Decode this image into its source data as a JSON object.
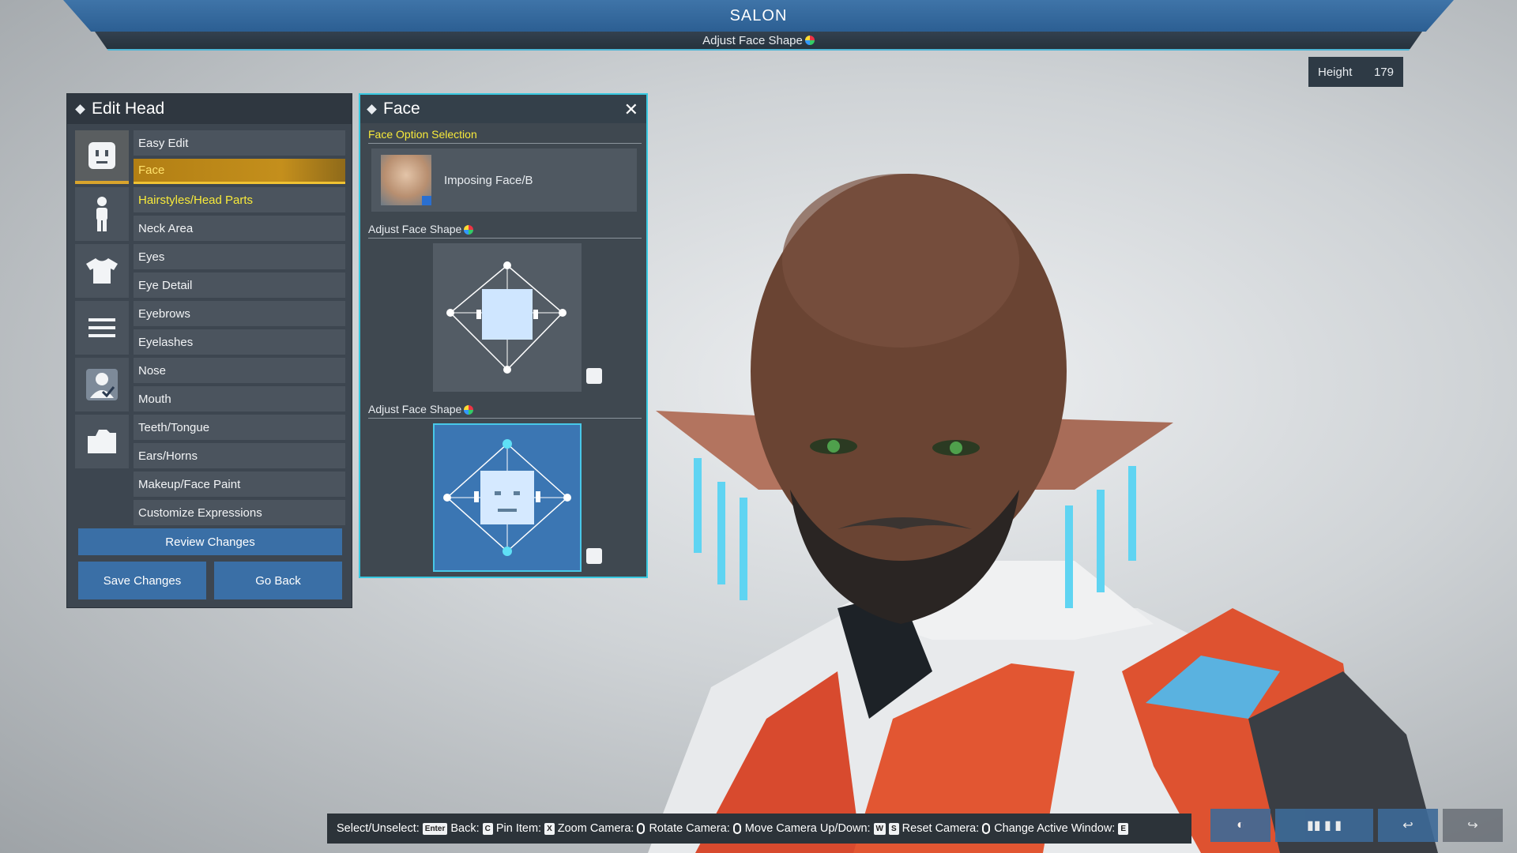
{
  "header": {
    "title": "SALON",
    "subtitle": "Adjust Face Shape"
  },
  "height_display": {
    "label": "Height",
    "value": "179"
  },
  "edit_head": {
    "title": "Edit Head",
    "menu": [
      {
        "label": "Easy Edit",
        "state": "normal"
      },
      {
        "label": "Face",
        "state": "selected"
      },
      {
        "label": "Hairstyles/Head Parts",
        "state": "highlight"
      },
      {
        "label": "Neck Area",
        "state": "normal"
      },
      {
        "label": "Eyes",
        "state": "normal"
      },
      {
        "label": "Eye Detail",
        "state": "normal"
      },
      {
        "label": "Eyebrows",
        "state": "normal"
      },
      {
        "label": "Eyelashes",
        "state": "normal"
      },
      {
        "label": "Nose",
        "state": "normal"
      },
      {
        "label": "Mouth",
        "state": "normal"
      },
      {
        "label": "Teeth/Tongue",
        "state": "normal"
      },
      {
        "label": "Ears/Horns",
        "state": "normal"
      },
      {
        "label": "Makeup/Face Paint",
        "state": "normal"
      },
      {
        "label": "Customize Expressions",
        "state": "normal"
      }
    ],
    "categories": [
      "head-icon",
      "body-icon",
      "shirt-icon",
      "menu-lines-icon",
      "id-card-icon",
      "folder-icon"
    ],
    "review_label": "Review Changes",
    "save_label": "Save Changes",
    "back_label": "Go Back"
  },
  "face_panel": {
    "title": "Face",
    "option_section": "Face Option Selection",
    "option_name": "Imposing Face/B",
    "adjust_section_1": "Adjust Face Shape",
    "adjust_section_2": "Adjust Face Shape"
  },
  "controls": {
    "select": "Select/Unselect:",
    "select_key": "Enter",
    "back": "Back:",
    "back_key": "C",
    "pin": "Pin Item:",
    "pin_key": "X",
    "zoom": "Zoom Camera:",
    "rotate": "Rotate Camera:",
    "move": "Move Camera Up/Down:",
    "move_key_1": "W",
    "move_key_2": "S",
    "reset": "Reset Camera:",
    "change": "Change Active Window:",
    "change_key": "E"
  },
  "colors": {
    "accent_blue": "#3a6fa6",
    "selected_gold": "#c48f1c",
    "highlight_yellow": "#f8ea3a",
    "cyan_border": "#38c8e0"
  }
}
